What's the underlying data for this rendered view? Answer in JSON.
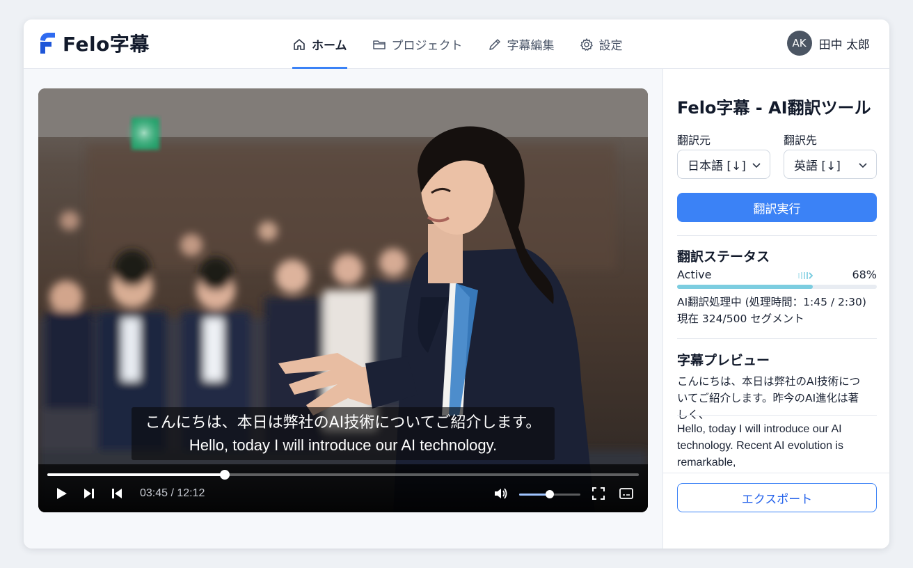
{
  "app": {
    "brand": "Felo字幕"
  },
  "nav": {
    "items": [
      {
        "label": "ホーム",
        "icon": "home-icon",
        "active": true
      },
      {
        "label": "プロジェクト",
        "icon": "folder-icon",
        "active": false
      },
      {
        "label": "字幕編集",
        "icon": "pencil-icon",
        "active": false
      },
      {
        "label": "設定",
        "icon": "gear-icon",
        "active": false
      }
    ]
  },
  "user": {
    "initials": "AK",
    "name": "田中 太郎"
  },
  "player": {
    "subtitle_jp": "こんにちは、本日は弊社のAI技術についてご紹介します。",
    "subtitle_en": "Hello, today I will introduce our AI technology.",
    "time": "03:45 / 12:12",
    "progress": 0.3,
    "volume": 0.5
  },
  "panel": {
    "title": "Felo字幕 - AI翻訳ツール",
    "source_label": "翻訳元",
    "target_label": "翻訳先",
    "source_value": "日本語 [↓]",
    "target_value": "英語 [↓]",
    "run_button": "翻訳実行",
    "status_title": "翻訳ステータス",
    "status_state": "Active",
    "status_percent_text": "68%",
    "status_percent": 68,
    "status_detail": "AI翻訳処理中 (処理時間：1:45 / 2:30)",
    "status_segments": "現在 324/500 セグメント",
    "preview_title": "字幕プレビュー",
    "preview_jp": "こんにちは、本日は弊社のAI技術についてご紹介します。昨今のAI進化は著しく、",
    "preview_en": "Hello, today I will introduce our AI technology. Recent AI evolution is remarkable,",
    "export_button": "エクスポート"
  },
  "colors": {
    "accent": "#3b82f6",
    "progress_teal": "#7ccde0"
  }
}
